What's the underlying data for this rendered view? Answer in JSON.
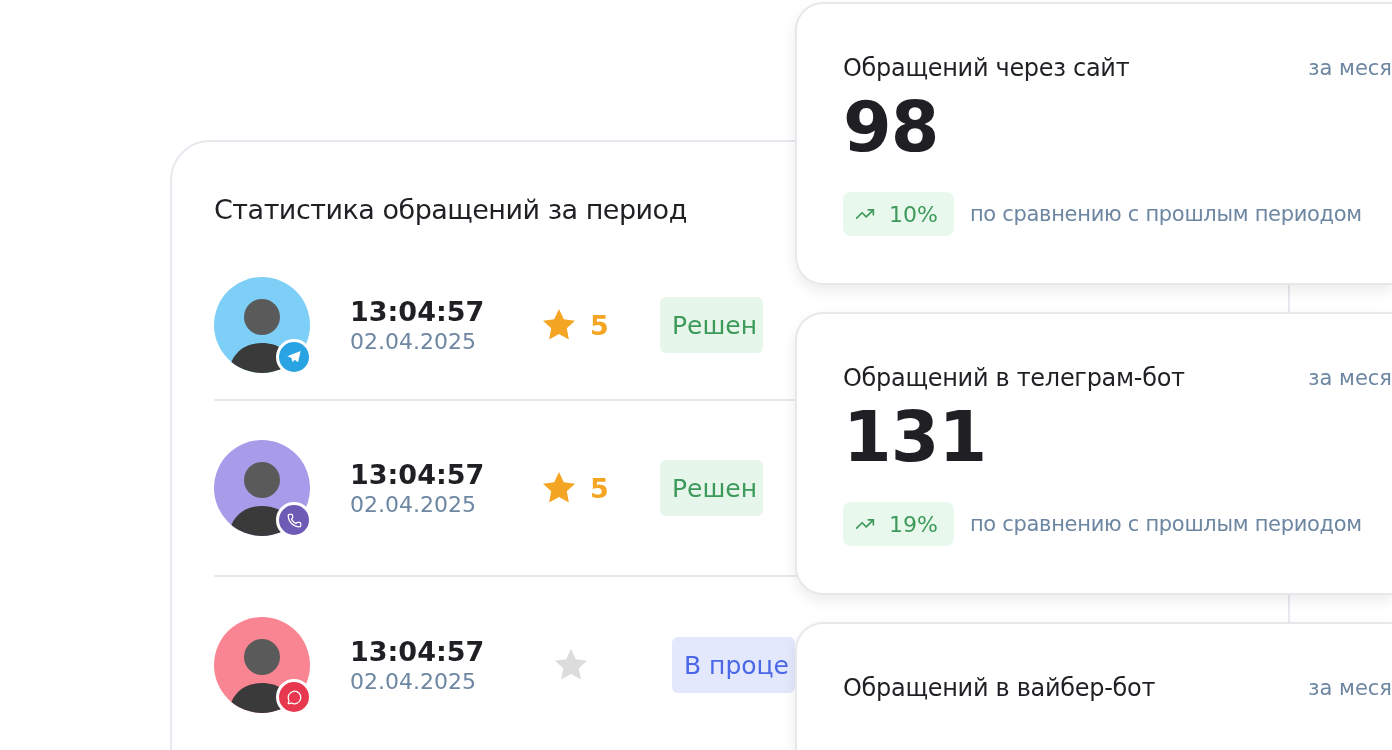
{
  "stats_panel": {
    "title": "Статистика обращений за период",
    "rows": [
      {
        "color": "#7dcff7",
        "channel": {
          "kind": "telegram"
        },
        "time": "13:04:57",
        "date": "02.04.2025",
        "starred": true,
        "rating": "5",
        "status": {
          "kind": "resolved",
          "label": "Решен"
        }
      },
      {
        "color": "#a89bea",
        "channel": {
          "kind": "viber"
        },
        "time": "13:04:57",
        "date": "02.04.2025",
        "starred": true,
        "rating": "5",
        "status": {
          "kind": "resolved",
          "label": "Решен"
        }
      },
      {
        "color": "#fa8592",
        "channel": {
          "kind": "chat"
        },
        "time": "13:04:57",
        "date": "02.04.2025",
        "starred": false,
        "status": {
          "kind": "in_progress",
          "label": "В проце"
        }
      }
    ]
  },
  "metric_cards": [
    {
      "title": "Обращений через сайт",
      "period": "за меся",
      "value": "98",
      "change": "10%",
      "comparison": "по сравнению с прошлым периодом"
    },
    {
      "title": "Обращений в телеграм-бот",
      "period": "за меся",
      "value": "131",
      "change": "19%",
      "comparison": "по сравнению с прошлым периодом"
    },
    {
      "title": "Обращений в вайбер-бот",
      "period": "за меся"
    }
  ]
}
